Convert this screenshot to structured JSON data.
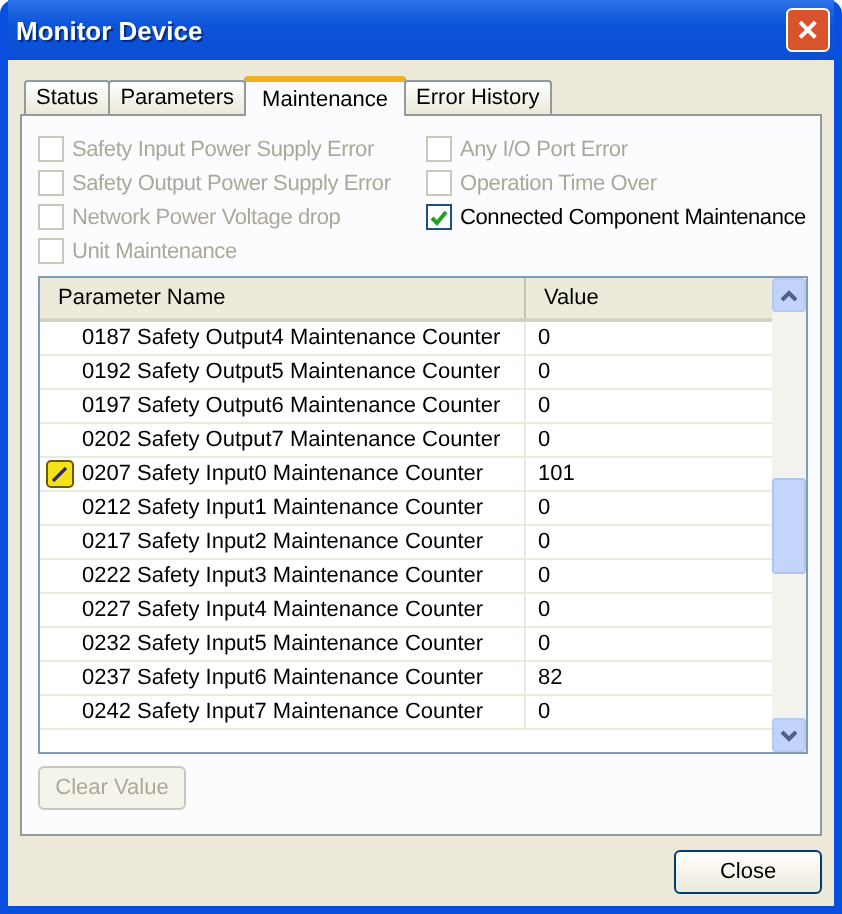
{
  "window": {
    "title": "Monitor Device",
    "close_glyph": "✕"
  },
  "tabs": [
    {
      "label": "Status",
      "selected": false
    },
    {
      "label": "Parameters",
      "selected": false
    },
    {
      "label": "Maintenance",
      "selected": true
    },
    {
      "label": "Error History",
      "selected": false
    }
  ],
  "checkbox_columns": [
    [
      {
        "label": "Safety Input Power Supply Error",
        "checked": false,
        "disabled": true
      },
      {
        "label": "Safety Output Power Supply Error",
        "checked": false,
        "disabled": true
      },
      {
        "label": "Network Power Voltage drop",
        "checked": false,
        "disabled": true
      },
      {
        "label": "Unit Maintenance",
        "checked": false,
        "disabled": true
      }
    ],
    [
      {
        "label": "Any I/O Port Error",
        "checked": false,
        "disabled": true
      },
      {
        "label": "Operation Time Over",
        "checked": false,
        "disabled": true
      },
      {
        "label": "Connected Component Maintenance",
        "checked": true,
        "disabled": false
      }
    ]
  ],
  "table": {
    "columns": [
      "Parameter Name",
      "Value"
    ],
    "rows": [
      {
        "name": "0187 Safety Output4 Maintenance Counter",
        "value": "0",
        "marked": false
      },
      {
        "name": "0192 Safety Output5 Maintenance Counter",
        "value": "0",
        "marked": false
      },
      {
        "name": "0197 Safety Output6 Maintenance Counter",
        "value": "0",
        "marked": false
      },
      {
        "name": "0202 Safety Output7 Maintenance Counter",
        "value": "0",
        "marked": false
      },
      {
        "name": "0207 Safety Input0 Maintenance Counter",
        "value": "101",
        "marked": true
      },
      {
        "name": "0212 Safety Input1 Maintenance Counter",
        "value": "0",
        "marked": false
      },
      {
        "name": "0217 Safety Input2 Maintenance Counter",
        "value": "0",
        "marked": false
      },
      {
        "name": "0222 Safety Input3 Maintenance Counter",
        "value": "0",
        "marked": false
      },
      {
        "name": "0227 Safety Input4 Maintenance Counter",
        "value": "0",
        "marked": false
      },
      {
        "name": "0232 Safety Input5 Maintenance Counter",
        "value": "0",
        "marked": false
      },
      {
        "name": "0237 Safety Input6 Maintenance Counter",
        "value": "82",
        "marked": false
      },
      {
        "name": "0242 Safety Input7 Maintenance Counter",
        "value": "0",
        "marked": false
      }
    ]
  },
  "clear_button": {
    "label": "Clear Value",
    "disabled": true
  },
  "close_button": {
    "label": "Close"
  }
}
